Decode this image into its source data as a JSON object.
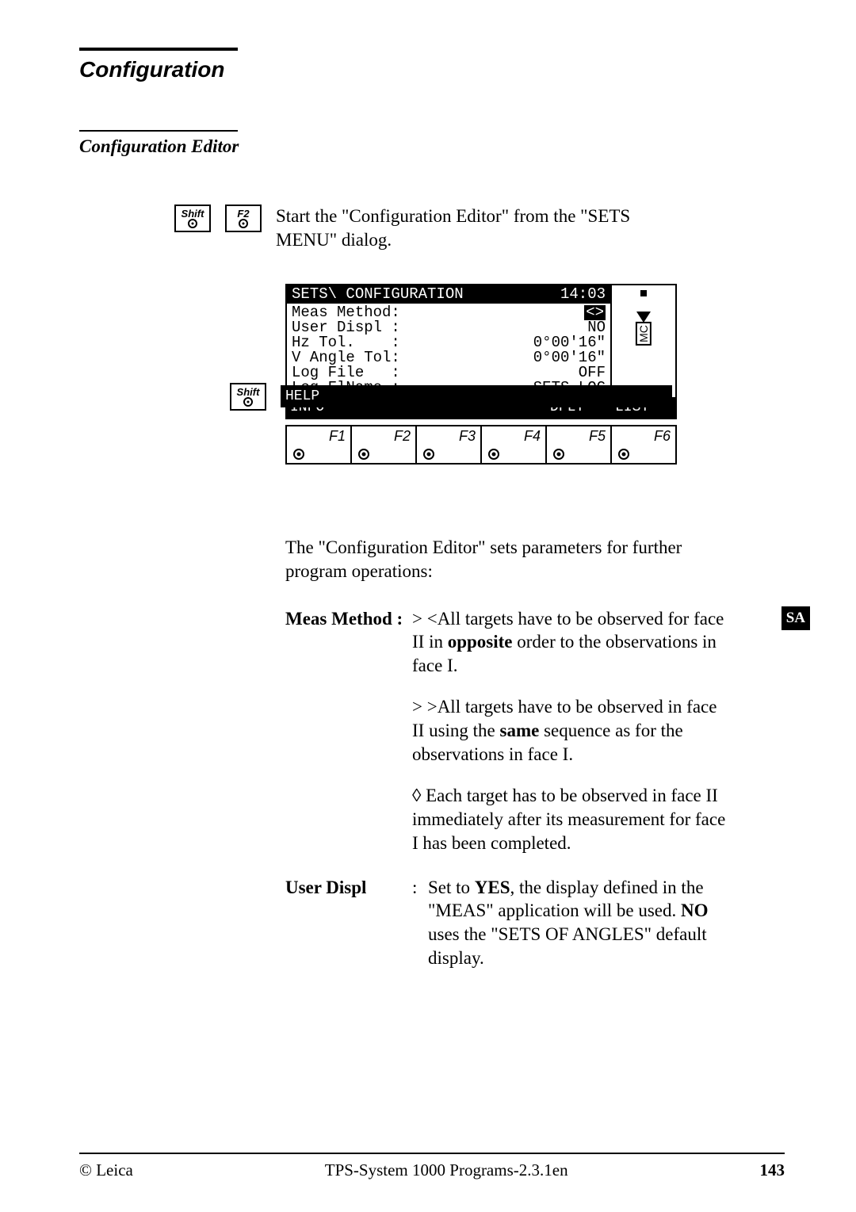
{
  "header": {
    "section": "Configuration",
    "subsection": "Configuration Editor"
  },
  "keys": {
    "shift": "Shift",
    "f2": "F2"
  },
  "intro": "Start the \"Configuration Editor\" from the \"SETS MENU\" dialog.",
  "screen": {
    "title_left": "SETS\\ CONFIGURATION",
    "title_time": "14:03",
    "side_mc": "MC",
    "rows": [
      {
        "label": "Meas Method:",
        "value": "<>"
      },
      {
        "label": "User Displ :",
        "value": "NO"
      },
      {
        "label": "Hz Tol.    :",
        "value": "0°00'16\""
      },
      {
        "label": "V Angle Tol:",
        "value": "0°00'16\""
      },
      {
        "label": "Log File   :",
        "value": "OFF"
      },
      {
        "label": "Log FlName :",
        "value": "SETS.LOG"
      }
    ],
    "softkeys1": [
      "INFO",
      "",
      "",
      "",
      "DFLT",
      "LIST"
    ],
    "softkeys2": [
      "HELP",
      "",
      "",
      "",
      "",
      ""
    ],
    "fkeys": [
      "F1",
      "F2",
      "F3",
      "F4",
      "F5",
      "F6"
    ]
  },
  "body": "The \"Configuration Editor\" sets parameters for further program operations:",
  "defs": {
    "meas_label": "Meas Method",
    "meas_colon": ":",
    "meas_p1a": "> <All targets have to be observed for face II in ",
    "meas_p1_bold": "opposite",
    "meas_p1b": " order to the observations in face I.",
    "meas_p2a": "> >All targets have to be observed in face II using the ",
    "meas_p2_bold": "same",
    "meas_p2b": " sequence as for the observations in face I.",
    "meas_p3": "◊ Each target has to be observed in face II immediately after its measurement for face I has been completed.",
    "user_label": "User Displ",
    "user_colon": ":",
    "user_p1a": "Set to ",
    "user_p1_bold1": "YES",
    "user_p1b": ", the display defined in the \"MEAS\" application will be used. ",
    "user_p1_bold2": "NO",
    "user_p1c": " uses the \"SETS OF ANGLES\" default display."
  },
  "side_tab": "SA",
  "footer": {
    "left": "© Leica",
    "center": "TPS-System 1000 Programs-2.3.1en",
    "page": "143"
  }
}
